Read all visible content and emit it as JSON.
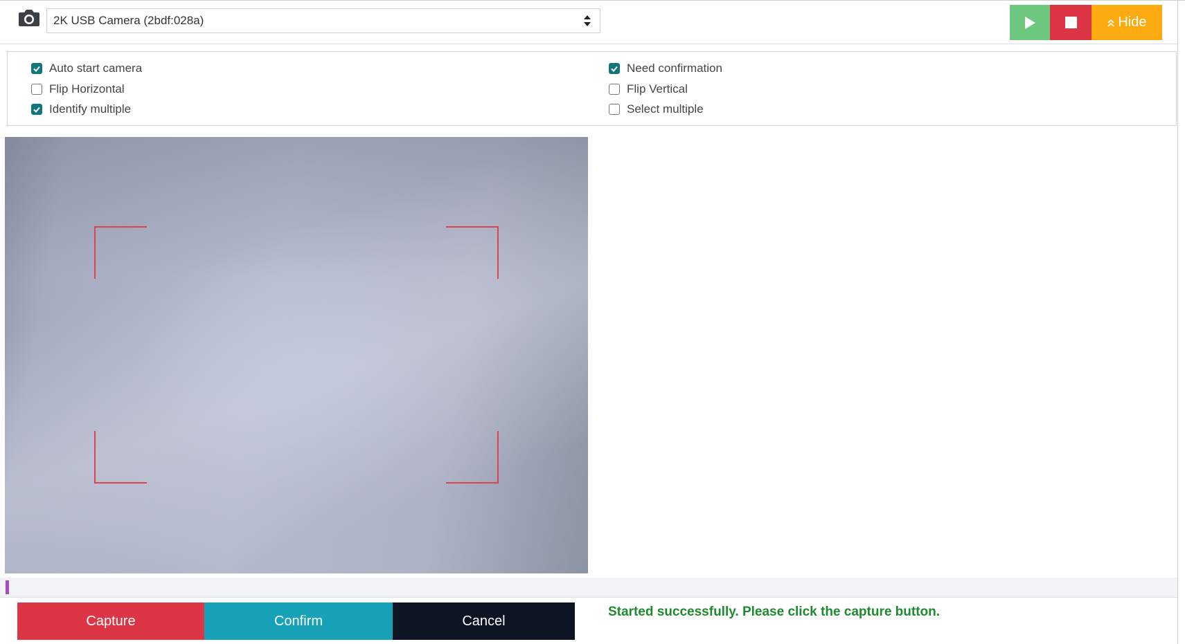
{
  "device_select": {
    "value": "2K USB Camera (2bdf:028a)"
  },
  "toolbar": {
    "play_icon": "play-icon",
    "stop_icon": "stop-icon",
    "hide_label": "Hide",
    "colors": {
      "play": "#6dc77f",
      "stop": "#dc3545",
      "hide": "#fcaa0f"
    }
  },
  "options": {
    "auto_start": {
      "label": "Auto start camera",
      "checked": true
    },
    "flip_horizontal": {
      "label": "Flip Horizontal",
      "checked": false
    },
    "identify_multiple": {
      "label": "Identify multiple",
      "checked": true
    },
    "need_confirmation": {
      "label": "Need confirmation",
      "checked": true
    },
    "flip_vertical": {
      "label": "Flip Vertical",
      "checked": false
    },
    "select_multiple": {
      "label": "Select multiple",
      "checked": false
    }
  },
  "progress": {
    "fraction": 0.003,
    "color": "#a64ec7"
  },
  "actions": {
    "capture": "Capture",
    "confirm": "Confirm",
    "cancel": "Cancel"
  },
  "status_message": "Started successfully. Please click the capture button.",
  "colors": {
    "checkbox_on": "#12777d",
    "scan_frame": "#d8454f",
    "status_text": "#1e8a2e"
  }
}
